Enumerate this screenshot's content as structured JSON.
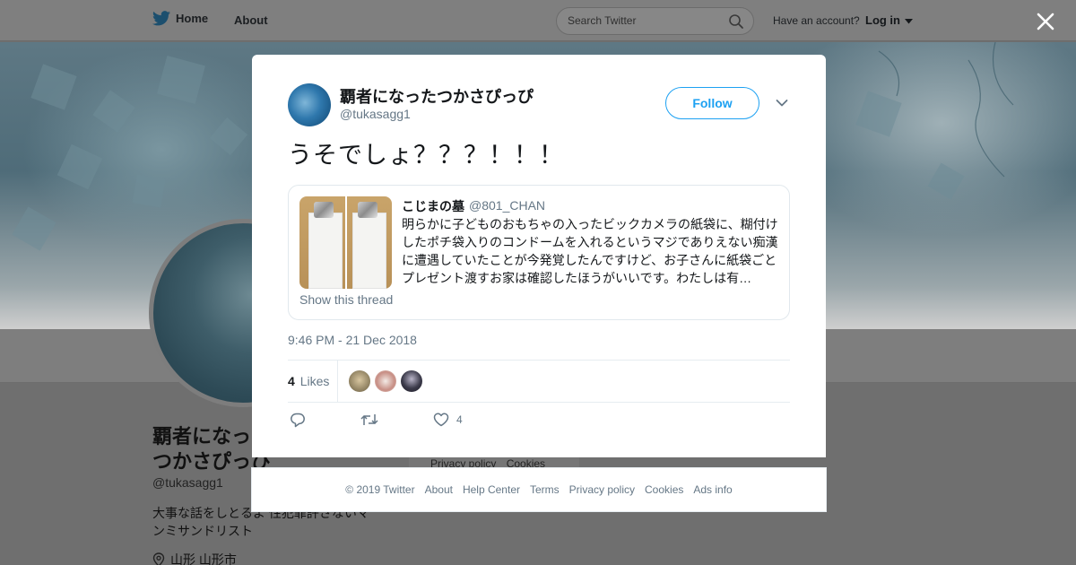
{
  "topbar": {
    "home_label": "Home",
    "about_label": "About",
    "search_placeholder": "Search Twitter",
    "have_account": "Have an account?",
    "login_label": "Log in"
  },
  "profile_bg": {
    "name": "覇者になったつかさぴっぴ",
    "handle": "@tukasagg1",
    "bio": "大事な話をしとるよ 性犯罪許さないマンミサンドリスト",
    "location": "山形 山形市",
    "links": [
      "Privacy policy",
      "Cookies"
    ]
  },
  "tweet": {
    "author_name": "覇者になったつかさぴっぴ",
    "author_handle": "@tukasagg1",
    "follow_label": "Follow",
    "text": "うそでしょ？？？！！！",
    "quote": {
      "name": "こじまの墓",
      "handle": "@801_CHAN",
      "text": "明らかに子どものおもちゃの入ったビックカメラの紙袋に、糊付けしたポチ袋入りのコンドームを入れるというマジでありえない痴漢に遭遇していたことが今発覚したんですけど、お子さんに紙袋ごとプレゼント渡すお家は確認したほうがいいです。わたしは有…",
      "show_thread": "Show this thread"
    },
    "timestamp": "9:46 PM - 21 Dec 2018",
    "likes_count": "4",
    "likes_label": "Likes",
    "like_action_count": "4"
  },
  "footer": {
    "links": [
      "© 2019 Twitter",
      "About",
      "Help Center",
      "Terms",
      "Privacy policy",
      "Cookies",
      "Ads info"
    ]
  },
  "colors": {
    "accent": "#1da1f2",
    "secondary_text": "#657786",
    "overlay": "#6f6f6f"
  },
  "icons": [
    "twitter-bird-icon",
    "search-icon",
    "caret-down-icon",
    "close-icon",
    "chevron-down-icon",
    "reply-icon",
    "retweet-icon",
    "heart-icon",
    "location-pin-icon"
  ]
}
